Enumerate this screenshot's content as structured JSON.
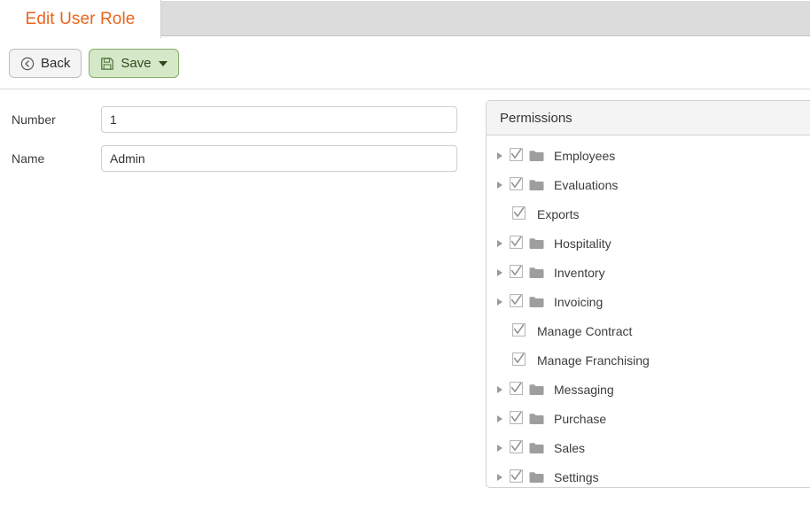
{
  "tab": {
    "label": "Edit User Role",
    "accent_color": "#e8651e"
  },
  "toolbar": {
    "back_label": "Back",
    "back_icon": "circle-left-arrow-icon",
    "save_label": "Save",
    "save_icon": "floppy-disk-icon",
    "save_caret_icon": "chevron-down-icon",
    "save_bg_color": "#d5e8c8",
    "save_border_color": "#86ae66"
  },
  "form": {
    "fields": [
      {
        "label": "Number",
        "value": "1",
        "placeholder": ""
      },
      {
        "label": "Name",
        "value": "Admin",
        "placeholder": ""
      }
    ]
  },
  "permissions": {
    "title": "Permissions",
    "items": [
      {
        "label": "Employees",
        "type": "folder",
        "checked": true,
        "expanded": false
      },
      {
        "label": "Evaluations",
        "type": "folder",
        "checked": true,
        "expanded": false
      },
      {
        "label": "Exports",
        "type": "leaf",
        "checked": true
      },
      {
        "label": "Hospitality",
        "type": "folder",
        "checked": true,
        "expanded": false
      },
      {
        "label": "Inventory",
        "type": "folder",
        "checked": true,
        "expanded": false
      },
      {
        "label": "Invoicing",
        "type": "folder",
        "checked": true,
        "expanded": false
      },
      {
        "label": "Manage Contract",
        "type": "leaf",
        "checked": true
      },
      {
        "label": "Manage Franchising",
        "type": "leaf",
        "checked": true
      },
      {
        "label": "Messaging",
        "type": "folder",
        "checked": true,
        "expanded": false
      },
      {
        "label": "Purchase",
        "type": "folder",
        "checked": true,
        "expanded": false
      },
      {
        "label": "Sales",
        "type": "folder",
        "checked": true,
        "expanded": false
      },
      {
        "label": "Settings",
        "type": "folder",
        "checked": true,
        "expanded": false
      }
    ]
  }
}
